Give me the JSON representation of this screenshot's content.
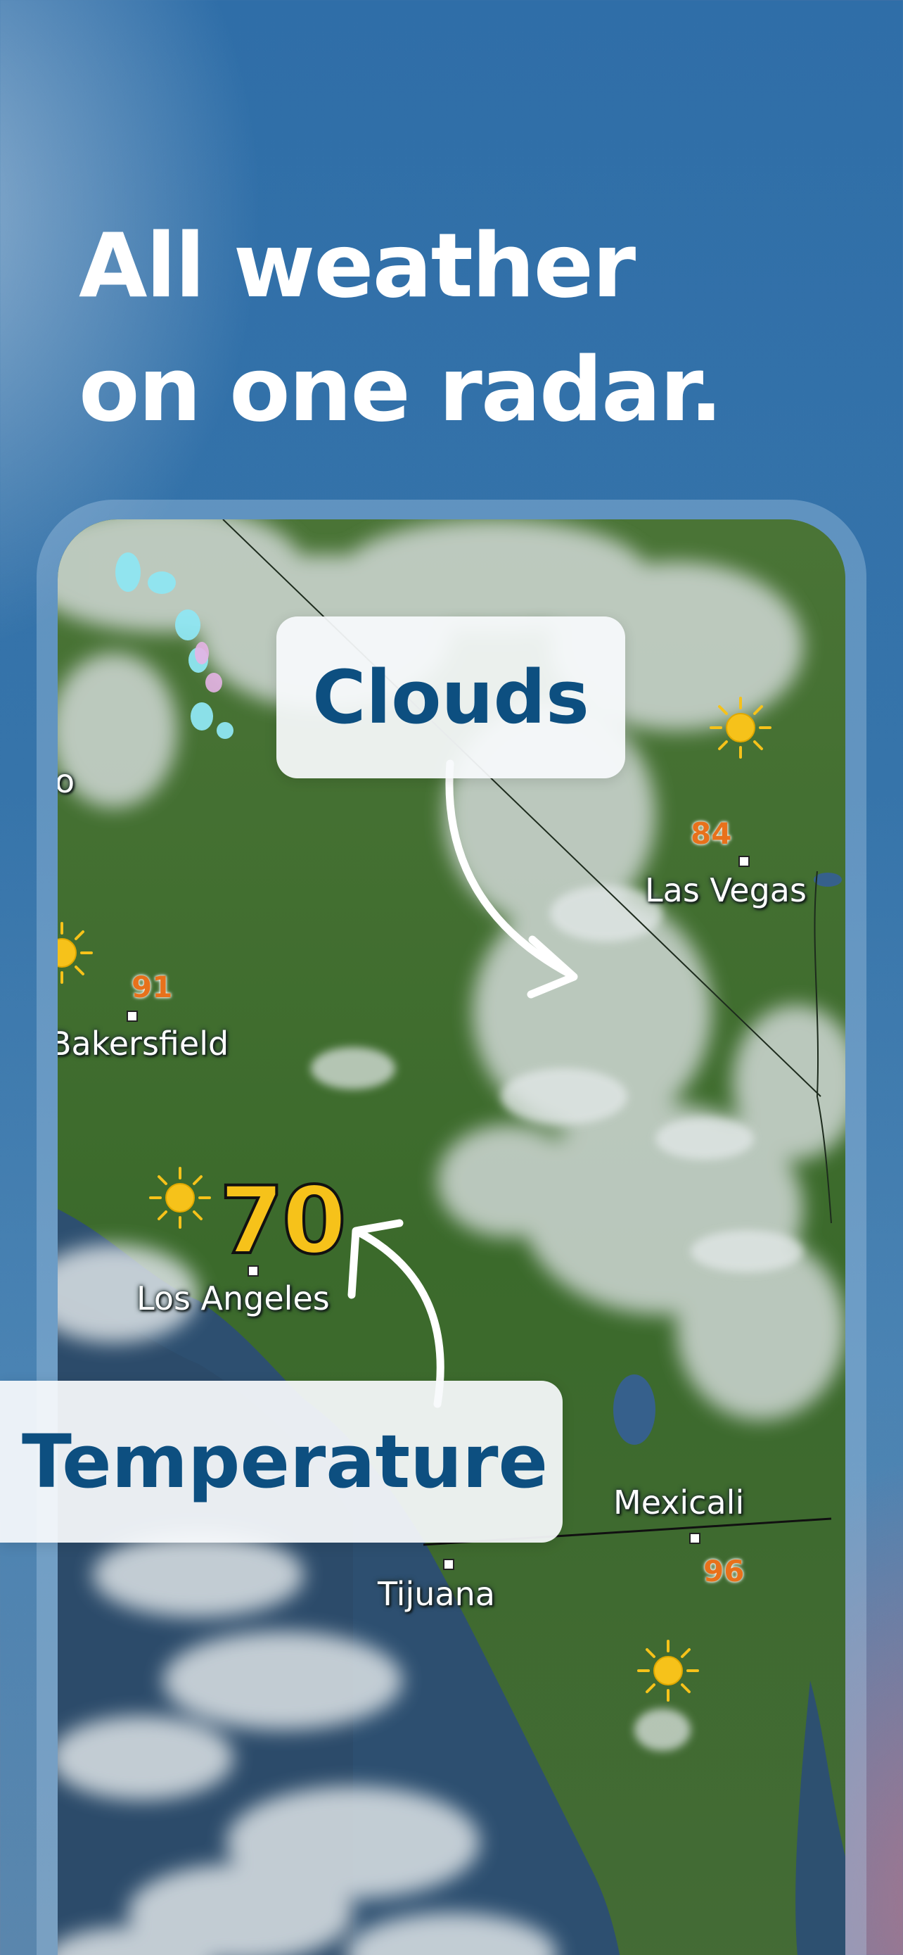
{
  "headline": {
    "line1": "All weather",
    "line2": "on one radar."
  },
  "callouts": {
    "clouds": "Clouds",
    "temperature": "Temperature"
  },
  "map": {
    "cities": [
      {
        "name": "Las Vegas",
        "temp": "84",
        "icon": "sun-icon"
      },
      {
        "name": "Bakersfield",
        "temp": "91",
        "icon": "sun-icon"
      },
      {
        "name": "Los Angeles",
        "temp": "70",
        "icon": "sun-icon"
      },
      {
        "name": "Mexicali",
        "temp": "96",
        "icon": "sun-icon"
      },
      {
        "name": "Tijuana",
        "temp": "",
        "icon": ""
      }
    ],
    "edge_label": "o"
  },
  "colors": {
    "background": "#3674aa",
    "headline_text": "#ffffff",
    "callout_text": "#0d4f80",
    "highlight_temp": "#f6c21a",
    "small_temp": "#e8711b",
    "land": "#3f6a30",
    "ocean": "#2e4f6e",
    "cloud": "#dfe4e6"
  }
}
